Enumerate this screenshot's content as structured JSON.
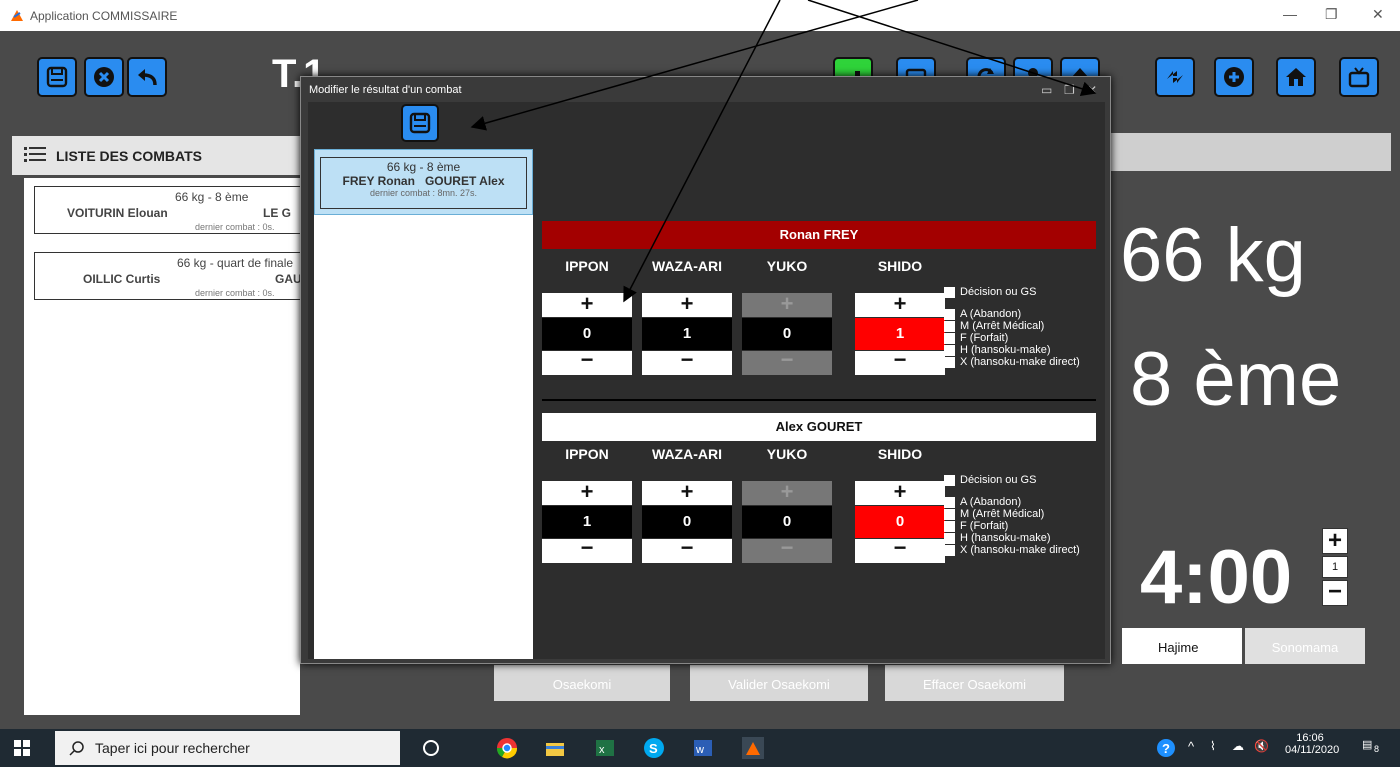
{
  "window": {
    "title": "Application COMMISSAIRE"
  },
  "header": {
    "big_title": "T.1"
  },
  "left": {
    "heading": "LISTE DES COMBATS",
    "cards": [
      {
        "category": "66 kg - 8 ème",
        "fighter1": "VOITURIN Elouan",
        "fighter2": "LE G",
        "last": "dernier combat : 0s."
      },
      {
        "category": "66 kg - quart de finale",
        "fighter1": "OILLIC Curtis",
        "fighter2": "GAU",
        "last": "dernier combat : 0s."
      }
    ]
  },
  "display": {
    "weight": "66 kg",
    "round": "8 ème",
    "timer": "4:00",
    "timer_step": "1",
    "plus": "+",
    "minus": "−"
  },
  "controls": {
    "hajime": "Hajime",
    "sonomama": "Sonomama",
    "osaekomi": "Osaekomi",
    "valider": "Valider Osaekomi",
    "effacer": "Effacer Osaekomi"
  },
  "dialog": {
    "title": "Modifier le résultat d'un combat",
    "list_card": {
      "category": "66 kg - 8 ème",
      "fighters": "FREY Ronan   GOURET Alex",
      "last": "dernier combat : 8mn. 27s."
    },
    "columns": [
      "IPPON",
      "WAZA-ARI",
      "YUKO",
      "SHIDO"
    ],
    "plus": "+",
    "minus": "−",
    "fighter1": {
      "name": "Ronan FREY",
      "ippon": "0",
      "waza": "1",
      "yuko": "0",
      "shido": "1"
    },
    "fighter2": {
      "name": "Alex GOURET",
      "ippon": "1",
      "waza": "0",
      "yuko": "0",
      "shido": "0"
    },
    "options": [
      "Décision ou GS",
      "A (Abandon)",
      "M (Arrêt Médical)",
      "F (Forfait)",
      "H (hansoku-make)",
      "X (hansoku-make direct)"
    ]
  },
  "taskbar": {
    "search_placeholder": "Taper ici pour rechercher",
    "time": "16:06",
    "date": "04/11/2020",
    "notif_count": "8"
  },
  "colors": {
    "accent": "#2a8cf0",
    "fighter1_bar": "#a30000",
    "shido_red": "#ff0000",
    "bg": "#4a4a4a"
  }
}
